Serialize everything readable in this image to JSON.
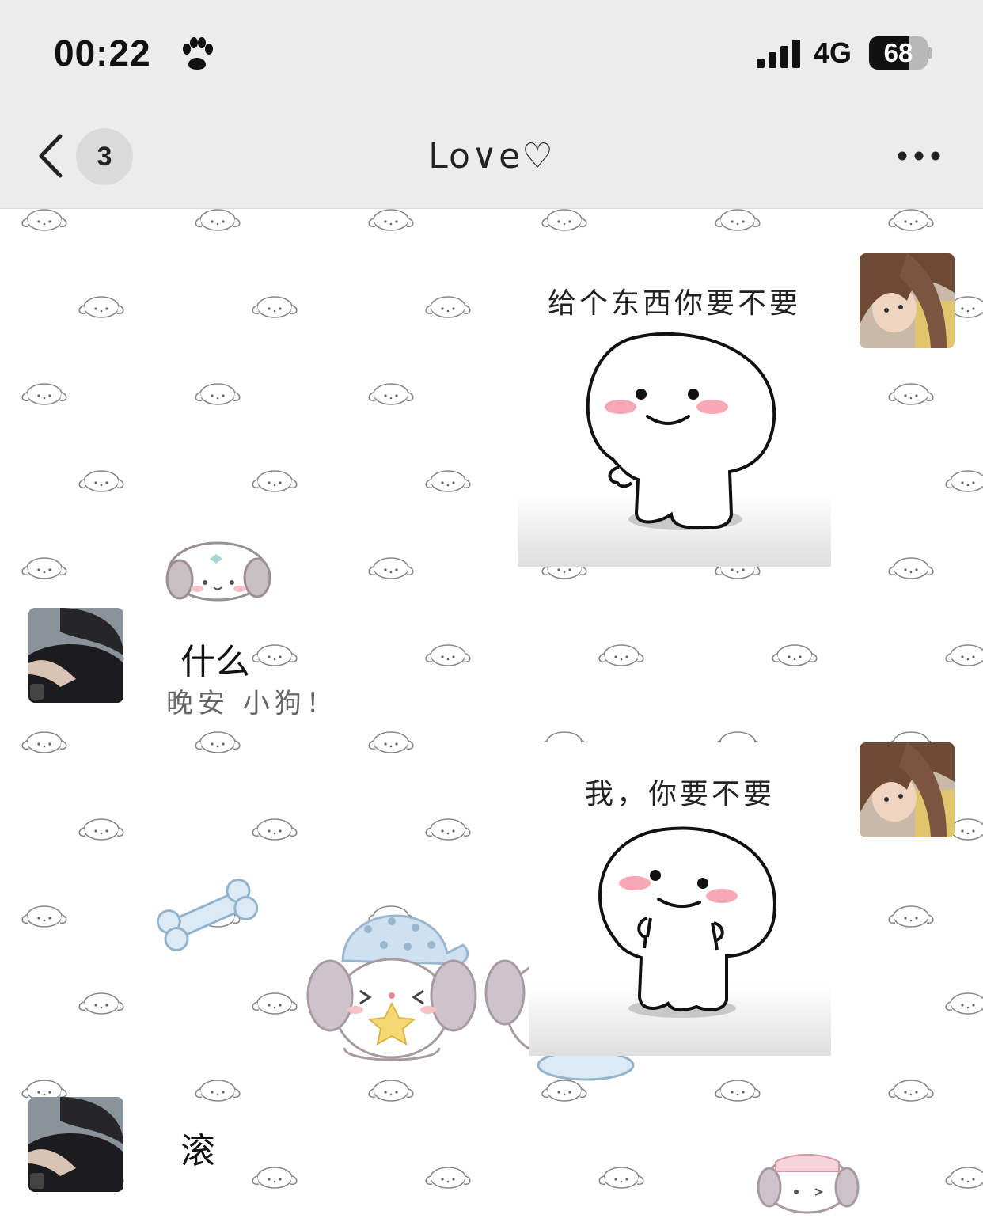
{
  "status_bar": {
    "time": "00:22",
    "network": "4G",
    "battery_level": "68",
    "battery_fraction": 0.68,
    "icons": [
      "paw-icon",
      "signal-icon",
      "battery-icon"
    ]
  },
  "nav": {
    "back_icon": "chevron-left-icon",
    "unread_count": "3",
    "title": "Lo∨e♡",
    "more_icon": "more-dots-icon"
  },
  "messages": [
    {
      "side": "right",
      "kind": "sticker",
      "caption": "给个东西你要不要"
    },
    {
      "side": "left",
      "kind": "text",
      "text": "什么"
    },
    {
      "side": "right",
      "kind": "sticker",
      "caption": "我，你要不要"
    },
    {
      "side": "left",
      "kind": "text",
      "text": "滚"
    }
  ],
  "wallpaper": {
    "text": "晚安 小狗！"
  },
  "colors": {
    "header_bg": "#ececec",
    "chat_bg": "#ffffff",
    "badge_bg": "#dadada",
    "blush": "#f7a8b4"
  }
}
